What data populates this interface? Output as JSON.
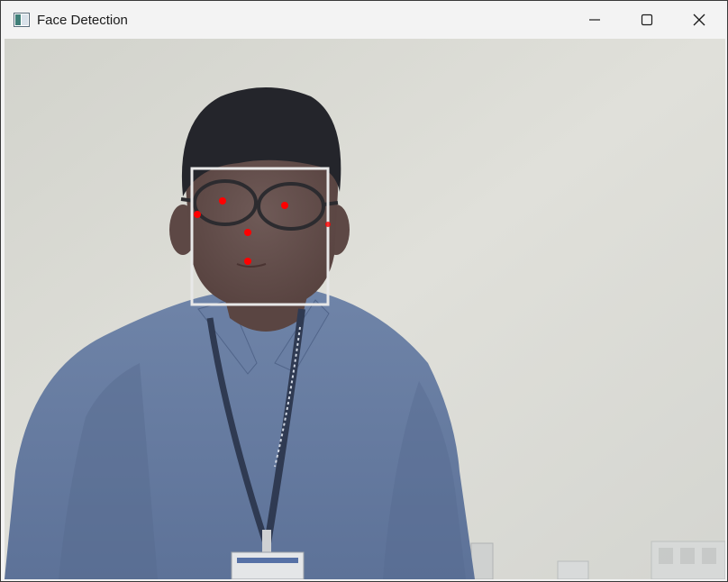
{
  "window": {
    "title": "Face Detection",
    "controls": {
      "minimize_icon": "minimize-icon",
      "maximize_icon": "maximize-icon",
      "close_icon": "close-icon"
    }
  },
  "video_frame": {
    "detection_box_color": "#e8e8e8",
    "landmark_color": "#ff0000",
    "landmark_count": 7
  }
}
